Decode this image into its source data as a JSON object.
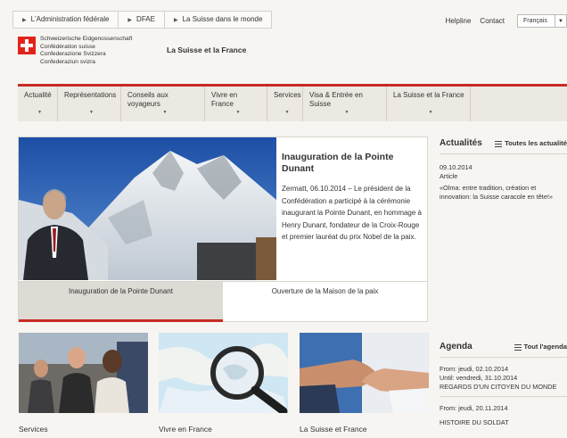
{
  "breadcrumb": [
    "L'Administration fédérale",
    "DFAE",
    "La Suisse dans le monde"
  ],
  "tools": {
    "helpline": "Helpline",
    "contact": "Contact",
    "language": "Français"
  },
  "header": {
    "federation_names": [
      "Schweizerische Eidgenossenschaft",
      "Confédération suisse",
      "Confederazione Svizzera",
      "Confederaziun svizra"
    ],
    "site_title": "La Suisse et la France"
  },
  "nav": [
    {
      "label": "Actualité"
    },
    {
      "label": "Représentations"
    },
    {
      "label": "Conseils aux voyageurs"
    },
    {
      "label": "Vivre en France"
    },
    {
      "label": "Services"
    },
    {
      "label": "Visa & Entrée en Suisse"
    },
    {
      "label": "La Suisse et la France"
    }
  ],
  "hero": {
    "title": "Inauguration de la Pointe Dunant",
    "body": "Zermatt, 06.10.2014 – Le président de la Confédération a participé à la cérémonie inaugurant la Pointe Dunant, en hommage à Henry Dunant, fondateur de la Croix-Rouge et premier lauréat du prix Nobel de la paix.",
    "tabs": [
      "Inauguration de la Pointe Dunant",
      "Ouverture de la Maison de la paix"
    ]
  },
  "news": {
    "heading": "Actualités",
    "all_link": "Toutes les actualité",
    "item": {
      "date": "09.10.2014",
      "type": "Article",
      "title": "«Olma: entre tradition, création et innovation: la Suisse caracole en tête!»"
    }
  },
  "agenda": {
    "heading": "Agenda",
    "all_link": "Tout l'agenda",
    "items": [
      {
        "from": "From: jeudi, 02.10.2014",
        "until": "Until: vendredi, 31.10.2014",
        "title": "REGARDS D'UN CITOYEN DU MONDE"
      },
      {
        "from": "From: jeudi, 20.11.2014",
        "title": "HISTOIRE DU SOLDAT"
      }
    ]
  },
  "tiles": [
    "Services",
    "Vivre en France",
    "La Suisse et France"
  ],
  "colors": {
    "accent": "#c72b25",
    "swiss_red": "#e2231a",
    "nav_bg": "#ece8e2"
  }
}
